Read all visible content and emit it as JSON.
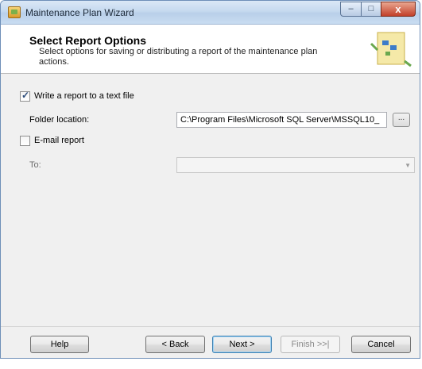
{
  "window": {
    "title": "Maintenance Plan Wizard"
  },
  "titlebar": {
    "min_glyph": "–",
    "max_glyph": "□",
    "close_glyph": "x"
  },
  "header": {
    "title": "Select Report Options",
    "description": "Select options for saving or distributing a report of the maintenance plan actions."
  },
  "options": {
    "write_report": {
      "label": "Write a report to a text file",
      "checked": true
    },
    "folder": {
      "label": "Folder location:",
      "value": "C:\\Program Files\\Microsoft SQL Server\\MSSQL10_",
      "browse_label": "..."
    },
    "email_report": {
      "label": "E-mail report",
      "checked": false
    },
    "to": {
      "label": "To:",
      "value": ""
    }
  },
  "buttons": {
    "help": "Help",
    "back": "< Back",
    "next": "Next >",
    "finish": "Finish >>|",
    "cancel": "Cancel"
  },
  "icons": [
    "app-wizard-icon",
    "minimize-icon",
    "maximize-icon",
    "close-icon",
    "wizard-header-icon",
    "checkmark-icon",
    "dropdown-arrow-icon"
  ],
  "colors": {
    "accent": "#3c7fb1",
    "titlebar": "#c5d9ef",
    "close": "#c2402a"
  }
}
